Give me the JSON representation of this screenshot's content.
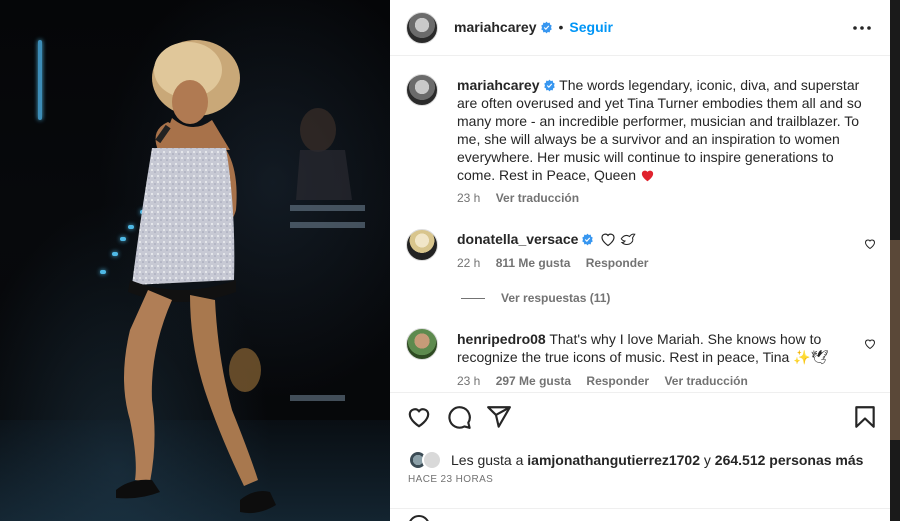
{
  "post": {
    "author": "mariahcarey",
    "follow_label": "Seguir",
    "caption_author": "mariahcarey",
    "caption": "The words legendary, iconic, diva, and superstar are often overused and yet Tina Turner embodies them all and so many more - an incredible performer, musician and trailblazer. To me, she will always be a survivor and an inspiration to women everywhere. Her music will continue to inspire generations to come. Rest in Peace, Queen",
    "caption_time": "23 h",
    "caption_translate": "Ver traducción"
  },
  "comments": [
    {
      "user": "donatella_versace",
      "text": "",
      "time": "22 h",
      "likes": "811 Me gusta",
      "reply": "Responder",
      "view_replies": "Ver respuestas (11)"
    },
    {
      "user": "henripedro08",
      "text": "That's why I love Mariah. She knows how to recognize the true icons of music. Rest in peace, Tina",
      "emoji_tail": "✨🕊",
      "time": "23 h",
      "likes": "297 Me gusta",
      "reply": "Responder",
      "translate": "Ver traducción"
    }
  ],
  "likes_summary": {
    "prefix": "Les gusta a ",
    "user": "iamjonathangutierrez1702",
    "middle": " y ",
    "count": "264.512 personas más"
  },
  "posted_ago": "HACE 23 HORAS",
  "colors": {
    "accent": "#0095f6",
    "verified": "#3897f0",
    "heart_red": "#ed4956",
    "text": "#262626",
    "muted": "#737373"
  },
  "icons": [
    "verified-badge-icon",
    "more-options-icon",
    "heart-icon",
    "comment-icon",
    "share-icon",
    "bookmark-icon",
    "red-heart-emoji",
    "white-heart-emoji",
    "dove-emoji"
  ]
}
